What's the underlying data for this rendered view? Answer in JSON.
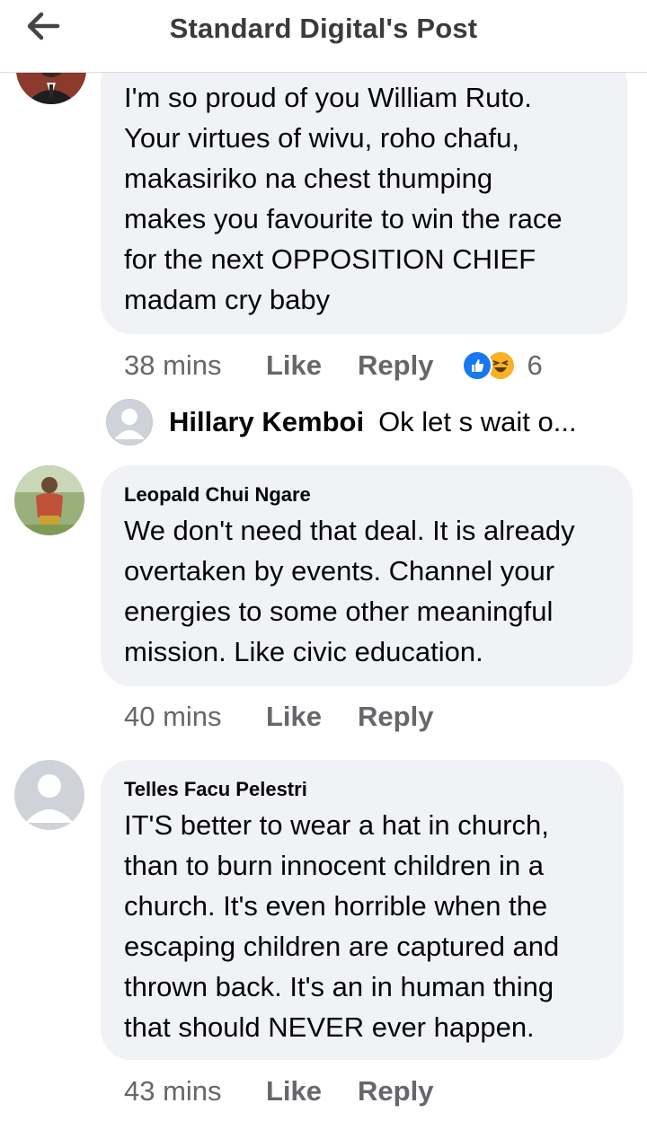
{
  "header": {
    "title": "Standard Digital's Post",
    "back_icon": "arrow-left-icon"
  },
  "comments": [
    {
      "author": "",
      "lines": [
        "I'm so proud of you William Ruto.",
        "Your virtues of wivu, roho chafu,",
        "makasiriko na chest thumping",
        "makes you favourite to win the race",
        "for the next OPPOSITION CHIEF",
        "madam cry baby"
      ],
      "time": "38 mins",
      "like_label": "Like",
      "reply_label": "Reply",
      "reactions": {
        "icons": [
          "like-reaction-icon",
          "haha-reaction-icon"
        ],
        "count": "6"
      },
      "reply_preview": {
        "name": "Hillary Kemboi",
        "text": "Ok let s wait o..."
      }
    },
    {
      "author": "Leopald Chui Ngare",
      "lines": [
        "We don't need that deal. It is already",
        "overtaken by events. Channel your",
        "energies to some other meaningful",
        "mission. Like civic education."
      ],
      "time": "40 mins",
      "like_label": "Like",
      "reply_label": "Reply"
    },
    {
      "author": "Telles Facu Pelestri",
      "lines": [
        "IT'S better to wear a hat in church,",
        "than to burn innocent children in a",
        "church. It's even horrible when the",
        "escaping children are captured and",
        "thrown back. It's an in human thing",
        "that should NEVER ever happen."
      ],
      "time": "43 mins",
      "like_label": "Like",
      "reply_label": "Reply"
    }
  ],
  "colors": {
    "bubble": "#f0f2f5",
    "meta_text": "#65676b",
    "like_blue": "#1877f2",
    "haha_yellow": "#f7b125"
  }
}
